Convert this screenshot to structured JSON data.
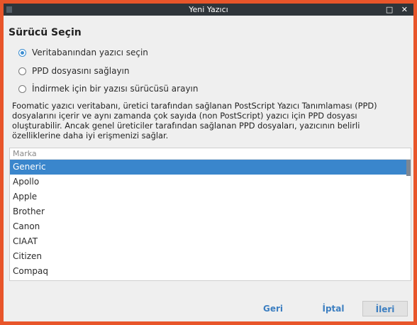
{
  "window": {
    "title": "Yeni Yazıcı",
    "controls": "□ ✕"
  },
  "heading": "Sürücü Seçin",
  "options": [
    {
      "label": "Veritabanından yazıcı seçin",
      "checked": true
    },
    {
      "label": "PPD dosyasını sağlayın",
      "checked": false
    },
    {
      "label": "İndirmek için bir yazısı sürücüsü arayın",
      "checked": false
    }
  ],
  "description": "Foomatic yazıcı veritabanı, üretici tarafından sağlanan PostScript Yazıcı Tanımlaması (PPD) dosyalarını içerir ve aynı zamanda çok sayıda (non PostScript) yazıcı için PPD dosyası oluşturabilir. Ancak genel üreticiler tarafından sağlanan PPD dosyaları, yazıcının belirli özelliklerine daha iyi erişmenizi sağlar.",
  "list": {
    "header": "Marka",
    "items": [
      "Generic",
      "Apollo",
      "Apple",
      "Brother",
      "Canon",
      "CIAAT",
      "Citizen",
      "Compaq"
    ],
    "selected": "Generic"
  },
  "buttons": {
    "back": "Geri",
    "cancel": "İptal",
    "next": "İleri"
  },
  "colors": {
    "accent": "#3a86cc",
    "titlebar": "#2f353a",
    "frame": "#e8552a"
  }
}
